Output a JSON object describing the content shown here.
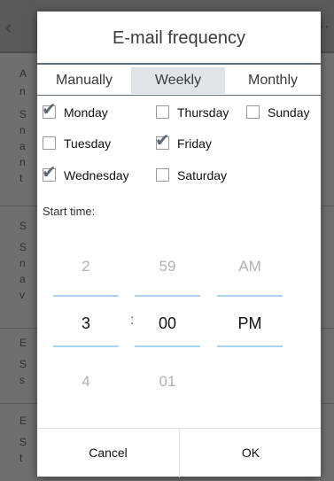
{
  "background": {
    "lines": [
      "A",
      "n",
      "S",
      "n",
      "a",
      "n",
      "t",
      "S",
      "S",
      "n",
      "a",
      "v",
      "E",
      "S",
      "s",
      "E",
      "S",
      "t"
    ]
  },
  "dialog": {
    "title": "E-mail frequency",
    "tabs": [
      {
        "label": "Manually",
        "selected": false
      },
      {
        "label": "Weekly",
        "selected": true
      },
      {
        "label": "Monthly",
        "selected": false
      }
    ],
    "days": [
      {
        "label": "Monday",
        "checked": true
      },
      {
        "label": "Thursday",
        "checked": false
      },
      {
        "label": "Sunday",
        "checked": false
      },
      {
        "label": "Tuesday",
        "checked": false
      },
      {
        "label": "Friday",
        "checked": true
      },
      {
        "label": "Wednesday",
        "checked": true
      },
      {
        "label": "Saturday",
        "checked": false
      }
    ],
    "start_label": "Start time:",
    "picker": {
      "hour": {
        "prev": "2",
        "current": "3",
        "next": "4"
      },
      "minute": {
        "prev": "59",
        "current": "00",
        "next": "01"
      },
      "ampm": {
        "prev": "AM",
        "current": "PM"
      },
      "separator": ":"
    },
    "buttons": {
      "cancel": "Cancel",
      "ok": "OK"
    }
  }
}
